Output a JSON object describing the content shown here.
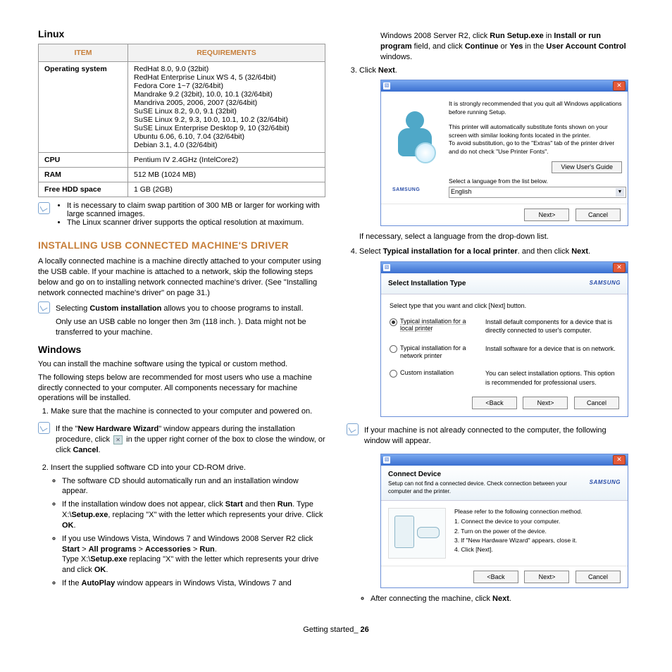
{
  "leftColumn": {
    "linuxHeading": "Linux",
    "table": {
      "headers": {
        "item": "ITEM",
        "req": "REQUIREMENTS"
      },
      "rows": {
        "os": {
          "label": "Operating system",
          "value": "RedHat 8.0, 9.0 (32bit)\nRedHat Enterprise Linux WS 4, 5 (32/64bit)\nFedora Core 1~7 (32/64bit)\nMandrake 9.2 (32bit), 10.0, 10.1 (32/64bit)\nMandriva 2005, 2006, 2007 (32/64bit)\nSuSE Linux 8.2, 9.0, 9.1 (32bit)\nSuSE Linux 9.2, 9.3, 10.0, 10.1, 10.2 (32/64bit)\nSuSE Linux Enterprise Desktop 9, 10 (32/64bit)\nUbuntu 6.06, 6.10, 7.04 (32/64bit)\nDebian 3.1, 4.0 (32/64bit)"
        },
        "cpu": {
          "label": "CPU",
          "value": "Pentium IV 2.4GHz (IntelCore2)"
        },
        "ram": {
          "label": "RAM",
          "value": "512 MB (1024 MB)"
        },
        "hdd": {
          "label": "Free HDD space",
          "value": "1 GB (2GB)"
        }
      }
    },
    "note1_b1": "It is necessary to claim swap partition of 300 MB or larger for working with large scanned images.",
    "note1_b2": "The Linux scanner driver supports the optical resolution at maximum.",
    "installHeading": "INSTALLING USB CONNECTED MACHINE'S DRIVER",
    "installPara": "A locally connected machine is a machine directly attached to your computer using the USB cable. If your machine is attached to a network, skip the following steps below and go on to installing network connected machine's driver. (See \"Installing network connected machine's driver\" on page 31.)",
    "note2_line1a": "Selecting ",
    "note2_line1b": "Custom installation",
    "note2_line1c": " allows you to choose programs to install.",
    "note2_line2": "Only use an USB cable no longer then 3m (118 inch. ). Data might not be transferred to your machine.",
    "windowsHeading": "Windows",
    "winP1": "You can install the machine software using the typical or custom method.",
    "winP2": "The following steps below are recommended for most users who use a machine directly connected to your computer. All components necessary for machine operations will be installed.",
    "step1": "Make sure that the machine is connected to your computer and powered on.",
    "step1Note_a": "If the \"",
    "step1Note_b": "New Hardware Wizard",
    "step1Note_c": "\" window appears during the installation procedure, click ",
    "step1Note_d": " in the upper right corner of the box to close the window, or click ",
    "step1Note_cancel": "Cancel",
    "step1Note_e": ".",
    "step2": "Insert the supplied software CD into your CD-ROM drive.",
    "step2_b1": "The software CD should automatically run and an installation window appear.",
    "step2_b2_a": "If the installation window does not appear, click ",
    "step2_b2_start": "Start",
    "step2_b2_b": " and then ",
    "step2_b2_run": "Run",
    "step2_b2_c": ". Type X:\\",
    "step2_b2_setup": "Setup.exe",
    "step2_b2_d": ", replacing \"X\" with the letter which represents your drive. Click ",
    "step2_b2_ok": "OK",
    "step2_b2_e": ".",
    "step2_b3_a": "If you use Windows Vista, Windows 7 and Windows 2008 Server R2 click ",
    "step2_b3_start": "Start",
    "step2_b3_gt1": " > ",
    "step2_b3_all": "All programs",
    "step2_b3_gt2": " > ",
    "step2_b3_acc": "Accessories",
    "step2_b3_gt3": " > ",
    "step2_b3_run": "Run",
    "step2_b3_b": ".",
    "step2_b3_c": "Type X:\\",
    "step2_b3_setup": "Setup.exe",
    "step2_b3_d": " replacing \"X\" with the letter which represents your drive and click ",
    "step2_b3_ok": "OK",
    "step2_b3_e": ".",
    "step2_b4_a": "If the ",
    "step2_b4_auto": "AutoPlay",
    "step2_b4_b": " window appears in Windows Vista, Windows 7 and"
  },
  "rightColumn": {
    "cont_a": "Windows 2008 Server R2, click ",
    "cont_run": "Run Setup.exe",
    "cont_b": " in ",
    "cont_install": "Install or run program",
    "cont_c": " field, and click ",
    "cont_continue": "Continue",
    "cont_d": " or ",
    "cont_yes": "Yes",
    "cont_e": " in the ",
    "cont_uac": "User Account Control",
    "cont_f": " windows.",
    "step3_a": "Click ",
    "step3_next": "Next",
    "step3_b": ".",
    "d1": {
      "rec1": "It is strongly recommended that you quit all Windows applications before running Setup.",
      "rec2a": "This printer will automatically substitute fonts shown on your screen with similar looking fonts located in the printer.",
      "rec2b": "To avoid substitution, go to the \"Extras\" tab of the printer driver and do not check \"Use Printer Fonts\".",
      "viewGuide": "View User's Guide",
      "langPrompt": "Select a language from the list below.",
      "langValue": "English",
      "next": "Next>",
      "cancel": "Cancel"
    },
    "afterD1": "If necessary, select a language from the drop-down list.",
    "step4_a": "Select ",
    "step4_b": "Typical installation for a local printer",
    "step4_c": ". and then click ",
    "step4_next": "Next",
    "step4_d": ".",
    "d2": {
      "title": "Select Installation Type",
      "prompt": "Select type that you want and click [Next] button.",
      "opt1Label": "Typical installation for a local printer",
      "opt1Desc": "Install default components for a device that is directly connected to user's computer.",
      "opt2Label": "Typical installation for a network printer",
      "opt2Desc": "Install software for a device that is on network.",
      "opt3Label": "Custom installation",
      "opt3Desc": "You can select installation options. This option is recommended for professional users.",
      "back": "<Back",
      "next": "Next>",
      "cancel": "Cancel"
    },
    "noteD2": "If your machine is not already connected to the computer, the following window will appear.",
    "d3": {
      "title": "Connect Device",
      "sub": "Setup can not find a connected device. Check connection between your computer and the printer.",
      "lead": "Please refer to the following connection method.",
      "s1": "1. Connect the device to your computer.",
      "s2": "2. Turn on the power of the device.",
      "s3": "3. If \"New Hardware Wizard\" appears, close it.",
      "s4": "4. Click [Next].",
      "back": "<Back",
      "next": "Next>",
      "cancel": "Cancel"
    },
    "afterD3_a": "After connecting the machine, click ",
    "afterD3_next": "Next",
    "afterD3_b": "."
  },
  "footer": {
    "text": "Getting started_ ",
    "page": "26"
  }
}
